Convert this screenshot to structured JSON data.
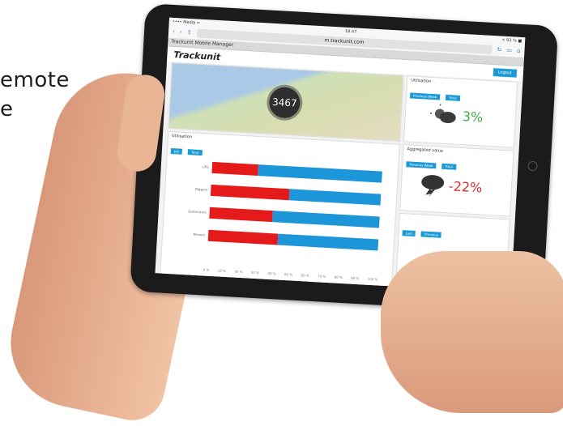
{
  "background": {
    "line1": "emote",
    "line2": "e"
  },
  "browser": {
    "status_left": "•••• Media ≈",
    "status_center": "18:47",
    "status_right": "≺ 93 % ■",
    "back": "‹",
    "forward": "›",
    "url": "m.trackunit.com",
    "tab_title": "Trackunit Mobile Manager"
  },
  "app": {
    "logo": "Trackunit",
    "logout_label": "Logout"
  },
  "map": {
    "count": "3467"
  },
  "utilization": {
    "title": "Utilisation",
    "pills": [
      "Job",
      "Total"
    ],
    "rows": [
      {
        "label": "Lifts",
        "value": 0.27
      },
      {
        "label": "Diggers",
        "value": 0.46
      },
      {
        "label": "Generators",
        "value": 0.37
      },
      {
        "label": "Movers",
        "value": 0.41
      }
    ],
    "ticks": [
      "0 %",
      "10 %",
      "20 %",
      "30 %",
      "40 %",
      "50 %",
      "60 %",
      "70 %",
      "80 %",
      "90 %",
      "100 %"
    ]
  },
  "weather_up": {
    "title": "Utilisation",
    "pills": [
      "Previous Week",
      "Total"
    ],
    "value": "3%"
  },
  "weather_down": {
    "title": "Aggregated value",
    "pills": [
      "Previous Week",
      "Total"
    ],
    "value": "-22%"
  },
  "third_card": {
    "pills": [
      "Last",
      "Previous"
    ]
  },
  "colors": {
    "accent": "#1a9ad6",
    "red": "#e51b1b",
    "blue": "#1c96d9",
    "green": "#3bb04a"
  }
}
